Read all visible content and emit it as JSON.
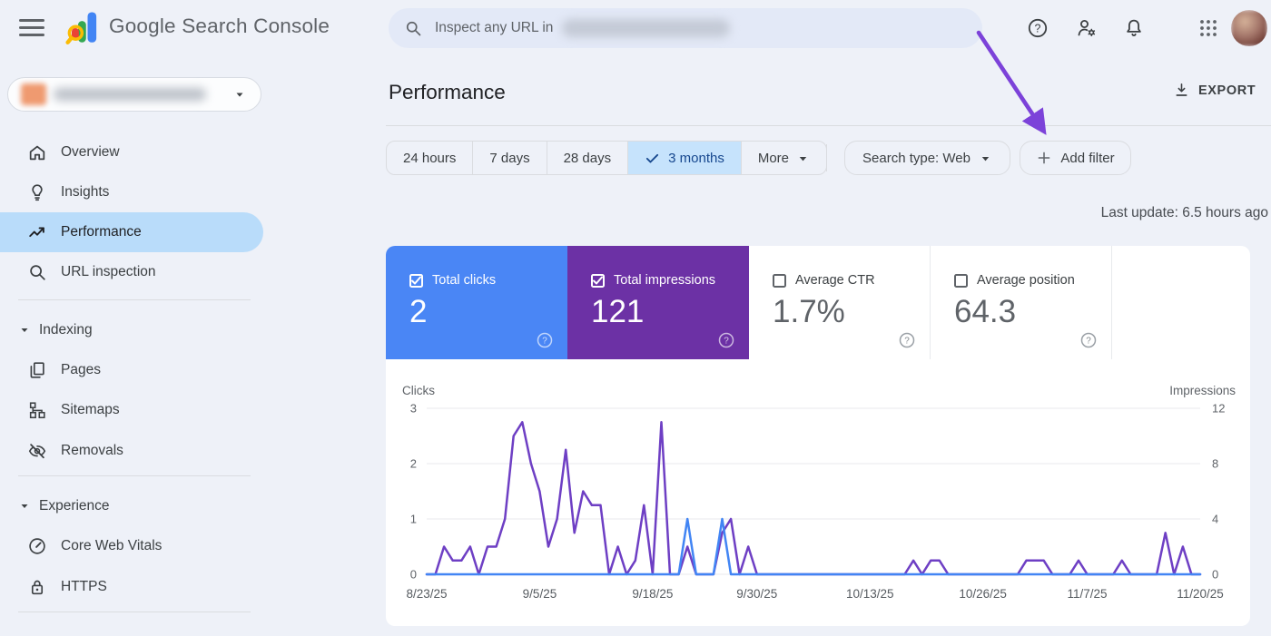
{
  "topbar": {
    "app_title": "Google Search Console",
    "search": {
      "placeholder": "Inspect any URL in"
    }
  },
  "sidebar": {
    "nav": [
      {
        "label": "Overview",
        "icon": "home-icon"
      },
      {
        "label": "Insights",
        "icon": "lightbulb-icon"
      },
      {
        "label": "Performance",
        "icon": "trending-up-icon",
        "selected": true
      },
      {
        "label": "URL inspection",
        "icon": "search-icon"
      }
    ],
    "sections": [
      {
        "label": "Indexing",
        "items": [
          {
            "label": "Pages",
            "icon": "pages-icon"
          },
          {
            "label": "Sitemaps",
            "icon": "sitemap-icon"
          },
          {
            "label": "Removals",
            "icon": "eye-off-icon"
          }
        ]
      },
      {
        "label": "Experience",
        "items": [
          {
            "label": "Core Web Vitals",
            "icon": "gauge-icon"
          },
          {
            "label": "HTTPS",
            "icon": "lock-icon"
          }
        ]
      }
    ]
  },
  "main": {
    "title": "Performance",
    "export_label": "EXPORT",
    "date_filters": [
      "24 hours",
      "7 days",
      "28 days",
      "3 months"
    ],
    "selected_date_filter": "3 months",
    "more_label": "More",
    "search_type_label": "Search type: Web",
    "add_filter_label": "Add filter",
    "last_update": "Last update: 6.5 hours ago",
    "cards": [
      {
        "label": "Total clicks",
        "value": "2",
        "checked": true,
        "bg": "#4a86f5"
      },
      {
        "label": "Total impressions",
        "value": "121",
        "checked": true,
        "bg": "#6c31a5"
      },
      {
        "label": "Average CTR",
        "value": "1.7%",
        "checked": false,
        "bg": "#ffffff"
      },
      {
        "label": "Average position",
        "value": "64.3",
        "checked": false,
        "bg": "#ffffff"
      }
    ]
  },
  "colors": {
    "clicks_blue": "#4285f4",
    "impressions_purple": "#6e3fc4",
    "selected_nav_pill": "#b9dcfa",
    "selected_chip": "#c6e3fc",
    "annotation_arrow": "#7c42d9"
  },
  "chart_data": {
    "type": "line",
    "title": "",
    "left_axis": {
      "label": "Clicks",
      "ticks": [
        0,
        1,
        2,
        3
      ],
      "max": 3
    },
    "right_axis": {
      "label": "Impressions",
      "ticks": [
        0,
        4,
        8,
        12
      ],
      "max": 12
    },
    "x_ticks": [
      {
        "day": 0,
        "label": "8/23/25"
      },
      {
        "day": 13,
        "label": "9/5/25"
      },
      {
        "day": 26,
        "label": "9/18/25"
      },
      {
        "day": 38,
        "label": "9/30/25"
      },
      {
        "day": 51,
        "label": "10/13/25"
      },
      {
        "day": 64,
        "label": "10/26/25"
      },
      {
        "day": 76,
        "label": "11/7/25"
      },
      {
        "day": 89,
        "label": "11/20/25"
      }
    ],
    "series": [
      {
        "name": "Clicks",
        "axis": "left",
        "color": "#4285f4",
        "values": [
          0,
          0,
          0,
          0,
          0,
          0,
          0,
          0,
          0,
          0,
          0,
          0,
          0,
          0,
          0,
          0,
          0,
          0,
          0,
          0,
          0,
          0,
          0,
          0,
          0,
          0,
          0,
          0,
          0,
          0,
          1,
          0,
          0,
          0,
          1,
          0,
          0,
          0,
          0,
          0,
          0,
          0,
          0,
          0,
          0,
          0,
          0,
          0,
          0,
          0,
          0,
          0,
          0,
          0,
          0,
          0,
          0,
          0,
          0,
          0,
          0,
          0,
          0,
          0,
          0,
          0,
          0,
          0,
          0,
          0,
          0,
          0,
          0,
          0,
          0,
          0,
          0,
          0,
          0,
          0,
          0,
          0,
          0,
          0,
          0,
          0,
          0,
          0,
          0,
          0
        ]
      },
      {
        "name": "Impressions",
        "axis": "right",
        "color": "#6e3fc4",
        "values": [
          0,
          0,
          2,
          1,
          1,
          2,
          0,
          2,
          2,
          4,
          10,
          11,
          8,
          6,
          2,
          4,
          9,
          3,
          6,
          5,
          5,
          0,
          2,
          0,
          1,
          5,
          0,
          11,
          0,
          0,
          2,
          0,
          0,
          0,
          3,
          4,
          0,
          2,
          0,
          0,
          0,
          0,
          0,
          0,
          0,
          0,
          0,
          0,
          0,
          0,
          0,
          0,
          0,
          0,
          0,
          0,
          1,
          0,
          1,
          1,
          0,
          0,
          0,
          0,
          0,
          0,
          0,
          0,
          0,
          1,
          1,
          1,
          0,
          0,
          0,
          1,
          0,
          0,
          0,
          0,
          1,
          0,
          0,
          0,
          0,
          3,
          0,
          2,
          0,
          0
        ]
      }
    ]
  }
}
